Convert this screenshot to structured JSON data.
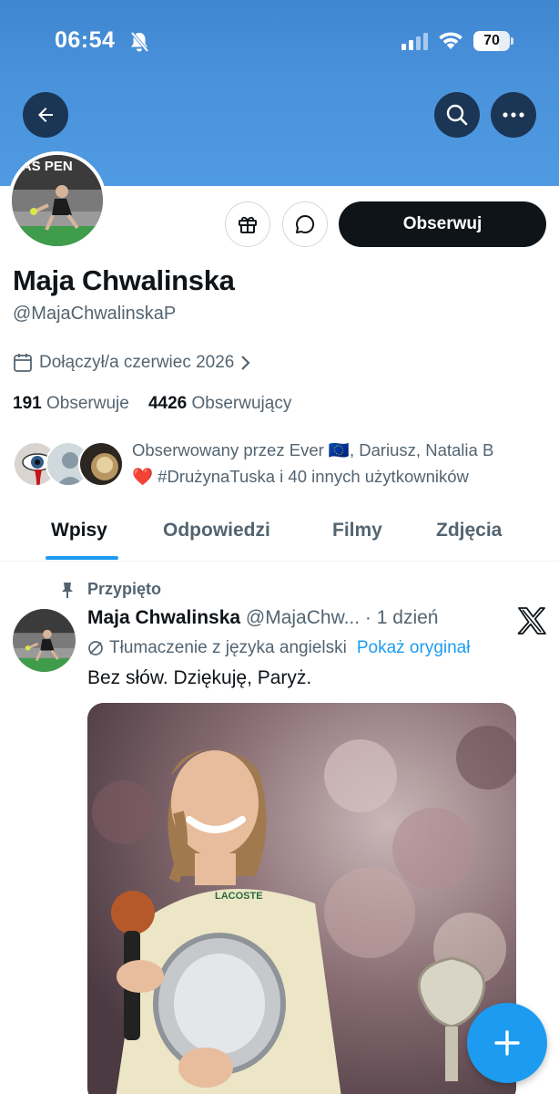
{
  "status_bar": {
    "time": "06:54",
    "battery": "70",
    "battery_fraction": 0.7
  },
  "profile": {
    "name": "Maja Chwalinska",
    "handle": "@MajaChwalinskaP",
    "joined": "Dołączył/a czerwiec 2026",
    "following_count": "191",
    "following_label": "Obserwuje",
    "followers_count": "4426",
    "followers_label": "Obserwujący",
    "followed_by_line1": "Obserwowany przez Ever 🇪🇺, Dariusz, Natalia B",
    "followed_by_line2": "❤️ #DrużynaTuska i 40 innych użytkowników",
    "follow_label": "Obserwuj",
    "avatar_text": "RAS PEN"
  },
  "tabs": [
    "Wpisy",
    "Odpowiedzi",
    "Filmy",
    "Zdjęcia"
  ],
  "post": {
    "pinned_label": "Przypięto",
    "author": "Maja Chwalinska",
    "meta": "@MajaChw... · 1 dzień",
    "translation_note": "Tłumaczenie z języka angielski",
    "show_original": "Pokaż oryginał",
    "text": "Bez słów. Dziękuję, Paryż.",
    "media_text": "LACOSTE"
  },
  "colors": {
    "accent": "#1d9bf0",
    "banner": "#4a93dc",
    "text": "#0f1419",
    "muted": "#536471"
  },
  "icons": [
    "back-arrow-icon",
    "search-icon",
    "more-icon",
    "gift-icon",
    "message-icon",
    "calendar-icon",
    "chevron-right-icon",
    "pin-icon",
    "x-logo-icon",
    "translate-icon",
    "plus-icon"
  ]
}
